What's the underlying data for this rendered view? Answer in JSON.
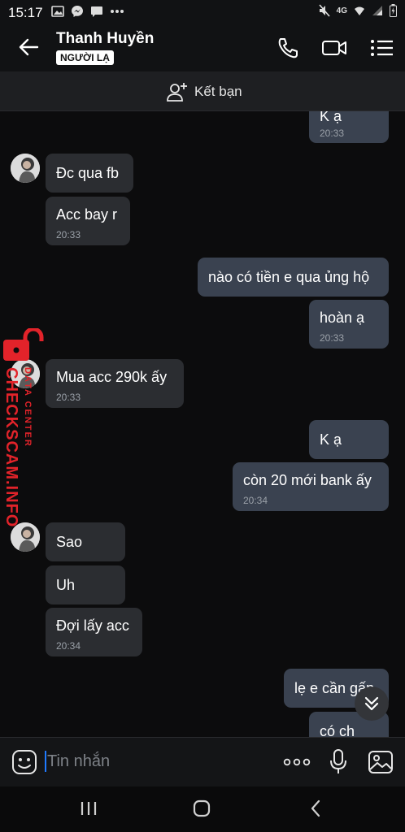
{
  "status_bar": {
    "time": "15:17",
    "network": "4G"
  },
  "header": {
    "name": "Thanh Huyền",
    "badge": "NGƯỜI LẠ"
  },
  "add_friend": {
    "label": "Kết bạn"
  },
  "messages": [
    {
      "side": "out",
      "text": "K ạ",
      "time": "20:33"
    },
    {
      "side": "in",
      "text": "Đc qua fb",
      "time": ""
    },
    {
      "side": "in",
      "text": "Acc bay r",
      "time": "20:33"
    },
    {
      "side": "out",
      "text": "nào có tiền e qua ủng hộ",
      "time": ""
    },
    {
      "side": "out",
      "text": "hoàn ạ",
      "time": "20:33"
    },
    {
      "side": "in",
      "text": "Mua acc 290k ấy",
      "time": "20:33"
    },
    {
      "side": "out",
      "text": "K ạ",
      "time": ""
    },
    {
      "side": "out",
      "text": "còn 20 mới bank ấy",
      "time": "20:34"
    },
    {
      "side": "in",
      "text": "Sao",
      "time": ""
    },
    {
      "side": "in",
      "text": "Uh",
      "time": ""
    },
    {
      "side": "in",
      "text": "Đợi lấy acc",
      "time": "20:34"
    },
    {
      "side": "out",
      "text": "lẹ e cần gấp",
      "time": ""
    },
    {
      "side": "out",
      "text": "có ch",
      "time": ""
    }
  ],
  "watermark": {
    "line1": "CHECKSCAM.INFO",
    "line2": "DATA CENTER"
  },
  "input": {
    "placeholder": "Tin nhắn"
  },
  "colors": {
    "incoming": "#2b2d31",
    "outgoing": "#3a4250",
    "background": "#0c0c0d",
    "watermark": "#e2232a",
    "caret": "#1f7aff"
  }
}
